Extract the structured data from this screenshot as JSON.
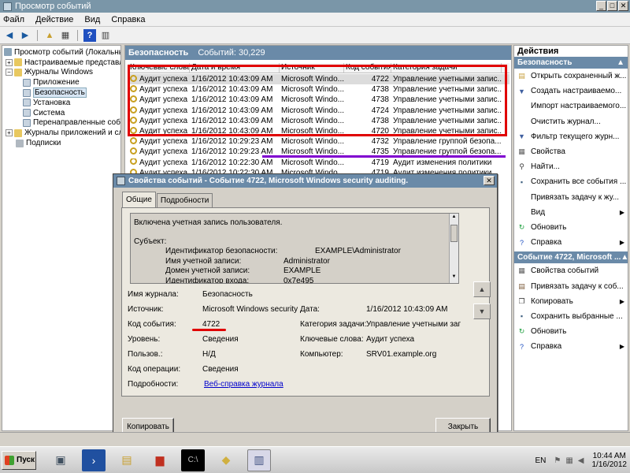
{
  "window": {
    "title": "Просмотр событий"
  },
  "menu": [
    "Файл",
    "Действие",
    "Вид",
    "Справка"
  ],
  "tree": [
    {
      "label": "Просмотр событий (Локальный)",
      "indent": 0,
      "exp": ""
    },
    {
      "label": "Настраиваемые представлен",
      "indent": 1,
      "exp": "+"
    },
    {
      "label": "Журналы Windows",
      "indent": 1,
      "exp": "−"
    },
    {
      "label": "Приложение",
      "indent": 2,
      "exp": ""
    },
    {
      "label": "Безопасность",
      "indent": 2,
      "exp": "",
      "selected": true
    },
    {
      "label": "Установка",
      "indent": 2,
      "exp": ""
    },
    {
      "label": "Система",
      "indent": 2,
      "exp": ""
    },
    {
      "label": "Перенаправленные событ",
      "indent": 2,
      "exp": ""
    },
    {
      "label": "Журналы приложений и служ",
      "indent": 1,
      "exp": "+"
    },
    {
      "label": "Подписки",
      "indent": 1,
      "exp": ""
    }
  ],
  "center": {
    "title": "Безопасность",
    "count": "Событий: 30,229",
    "columns": [
      "Ключевые слова",
      "Дата и время",
      "Источник",
      "Код события",
      "Категория задачи"
    ],
    "rows": [
      [
        "Аудит успеха",
        "1/16/2012 10:43:09 AM",
        "Microsoft Windo...",
        "4722",
        "Управление учетными запис..."
      ],
      [
        "Аудит успеха",
        "1/16/2012 10:43:09 AM",
        "Microsoft Windo...",
        "4738",
        "Управление учетными запис..."
      ],
      [
        "Аудит успеха",
        "1/16/2012 10:43:09 AM",
        "Microsoft Windo...",
        "4738",
        "Управление учетными запис..."
      ],
      [
        "Аудит успеха",
        "1/16/2012 10:43:09 AM",
        "Microsoft Windo...",
        "4724",
        "Управление учетными запис..."
      ],
      [
        "Аудит успеха",
        "1/16/2012 10:43:09 AM",
        "Microsoft Windo...",
        "4738",
        "Управление учетными запис..."
      ],
      [
        "Аудит успеха",
        "1/16/2012 10:43:09 AM",
        "Microsoft Windo...",
        "4720",
        "Управление учетными запис..."
      ],
      [
        "Аудит успеха",
        "1/16/2012 10:29:23 AM",
        "Microsoft Windo...",
        "4732",
        "Управление группой безопа..."
      ],
      [
        "Аудит успеха",
        "1/16/2012 10:29:23 AM",
        "Microsoft Windo...",
        "4735",
        "Управление группой безопа..."
      ],
      [
        "Аудит успеха",
        "1/16/2012 10:22:30 AM",
        "Microsoft Windo...",
        "4719",
        "Аудит изменения политики"
      ],
      [
        "Аудит успеха",
        "1/16/2012 10:22:30 AM",
        "Microsoft Windo...",
        "4719",
        "Аудит изменения политики"
      ]
    ]
  },
  "actions": {
    "title": "Действия",
    "section1": "Безопасность",
    "items1": [
      {
        "label": "Открыть сохраненный ж...",
        "icon": "folder-open-icon",
        "glyph": "▤",
        "color": "#c8a040",
        "arrow": false
      },
      {
        "label": "Создать настраиваемо...",
        "icon": "filter-create-icon",
        "glyph": "▼",
        "color": "#4060a0",
        "arrow": false
      },
      {
        "label": "Импорт настраиваемого...",
        "icon": "import-icon",
        "glyph": "",
        "color": "#000",
        "arrow": false
      },
      {
        "label": "Очистить журнал...",
        "icon": "clear-log-icon",
        "glyph": "",
        "color": "#000",
        "arrow": false
      },
      {
        "label": "Фильтр текущего журн...",
        "icon": "filter-icon",
        "glyph": "▼",
        "color": "#4060a0",
        "arrow": false
      },
      {
        "label": "Свойства",
        "icon": "properties-icon",
        "glyph": "▦",
        "color": "#606060",
        "arrow": false
      },
      {
        "label": "Найти...",
        "icon": "find-icon",
        "glyph": "⚲",
        "color": "#404040",
        "arrow": false
      },
      {
        "label": "Сохранить все события ...",
        "icon": "save-icon",
        "glyph": "▪",
        "color": "#406080",
        "arrow": false
      },
      {
        "label": "Привязать задачу к жу...",
        "icon": "attach-task-icon",
        "glyph": "",
        "color": "#000",
        "arrow": false
      },
      {
        "label": "Вид",
        "icon": "view-icon",
        "glyph": "",
        "color": "#000",
        "arrow": true
      },
      {
        "label": "Обновить",
        "icon": "refresh-icon",
        "glyph": "↻",
        "color": "#20a040",
        "arrow": false
      },
      {
        "label": "Справка",
        "icon": "help-icon",
        "glyph": "?",
        "color": "#2050c0",
        "arrow": true
      }
    ],
    "section2": "Событие 4722, Microsoft ...",
    "items2": [
      {
        "label": "Свойства событий",
        "icon": "event-properties-icon",
        "glyph": "▦",
        "color": "#606060",
        "arrow": false
      },
      {
        "label": "Привязать задачу к соб...",
        "icon": "attach-task-event-icon",
        "glyph": "▤",
        "color": "#806040",
        "arrow": false
      },
      {
        "label": "Копировать",
        "icon": "copy-icon",
        "glyph": "❐",
        "color": "#404040",
        "arrow": true
      },
      {
        "label": "Сохранить выбранные ...",
        "icon": "save-selected-icon",
        "glyph": "▪",
        "color": "#406080",
        "arrow": false
      },
      {
        "label": "Обновить",
        "icon": "refresh-icon",
        "glyph": "↻",
        "color": "#20a040",
        "arrow": false
      },
      {
        "label": "Справка",
        "icon": "help-icon",
        "glyph": "?",
        "color": "#2050c0",
        "arrow": true
      }
    ]
  },
  "dialog": {
    "title": "Свойства событий - Событие 4722, Microsoft Windows security auditing.",
    "tabs": [
      "Общие",
      "Подробности"
    ],
    "description": "Включена учетная запись пользователя.",
    "subject_label": "Субъект:",
    "subject": [
      [
        "Идентификатор безопасности:",
        "EXAMPLE\\Administrator"
      ],
      [
        "Имя учетной записи:",
        "Administrator"
      ],
      [
        "Домен учетной записи:",
        "EXAMPLE"
      ],
      [
        "Идентификатор входа:",
        "0x7e495"
      ]
    ],
    "fields": {
      "log_name_label": "Имя журнала:",
      "log_name": "Безопасность",
      "source_label": "Источник:",
      "source": "Microsoft Windows security",
      "date_label": "Дата:",
      "date": "1/16/2012 10:43:09 AM",
      "event_id_label": "Код события:",
      "event_id": "4722",
      "task_cat_label": "Категория задачи:",
      "task_cat": "Управление учетными заг",
      "level_label": "Уровень:",
      "level": "Сведения",
      "keywords_label": "Ключевые слова:",
      "keywords": "Аудит успеха",
      "user_label": "Пользов.:",
      "user": "Н/Д",
      "computer_label": "Компьютер:",
      "computer": "SRV01.example.org",
      "opcode_label": "Код операции:",
      "opcode": "Сведения",
      "more_label": "Подробности:",
      "more_link": "Веб-справка журнала"
    },
    "copy_button": "Копировать",
    "close_button": "Закрыть"
  },
  "taskbar": {
    "start": "Пуск",
    "lang": "EN",
    "time": "10:44 AM",
    "date": "1/16/2012"
  }
}
